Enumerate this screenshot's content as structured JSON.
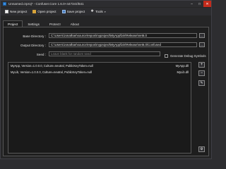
{
  "window": {
    "title": "Unnamed.crproj* - Confuser.Core 1.6.0+447341f641",
    "minimize_glyph": "–",
    "maximize_glyph": "□",
    "close_glyph": "✕"
  },
  "toolbar": {
    "new_project": "New project",
    "open_project": "Open project",
    "save_project": "Save project",
    "tools": "Tools",
    "tools_caret": "▾",
    "tools_glyph": "✱"
  },
  "tabs": [
    {
      "label": "Project",
      "active": true
    },
    {
      "label": "Settings",
      "active": false
    },
    {
      "label": "Protect!",
      "active": false
    },
    {
      "label": "About",
      "active": false
    }
  ],
  "project": {
    "base_directory_label": "Base Directory :",
    "base_directory_value": "C:\\Users\\Jonathan\\source\\repos\\myproject\\MyApp\\bin\\Release\\net6.0",
    "output_directory_label": "Output Directory :",
    "output_directory_value": "C:\\Users\\Jonathan\\source\\repos\\myproject\\MyApp\\bin\\Release\\net6.0\\Confused",
    "seed_label": "Seed :",
    "seed_placeholder": "Leave blank for random seed",
    "seed_value": "",
    "generate_debug_symbols_label": "Generate Debug Symbols",
    "generate_debug_symbols_checked": false,
    "browse_glyph": "...",
    "modules": [
      {
        "name": "MyApp, Version=1.0.0.0, Culture=neutral, PublicKeyToken=null",
        "file": "MyApp.dll"
      },
      {
        "name": "MyLib, Version=1.0.0.0, Culture=neutral, PublicKeyToken=null",
        "file": "MyLib.dll"
      }
    ],
    "add_glyph": "+",
    "remove_glyph": "−",
    "edit_glyph": "✎",
    "advanced_glyph": "⚙"
  }
}
